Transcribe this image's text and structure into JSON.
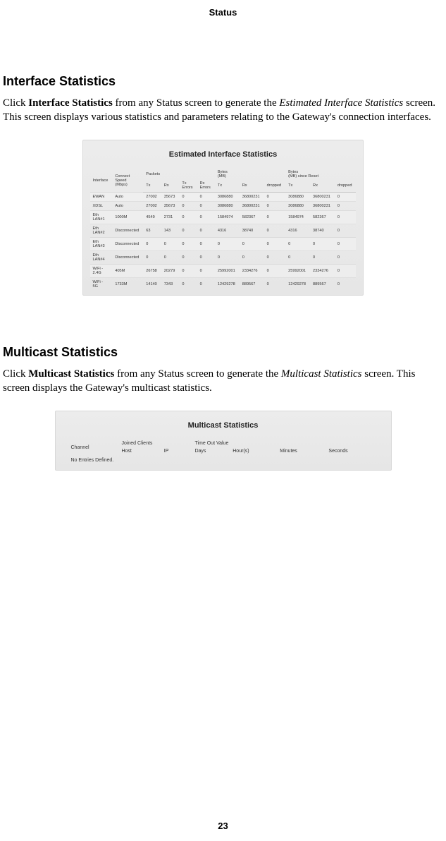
{
  "header": "Status",
  "page_number": "23",
  "section1": {
    "heading": "Interface Statistics",
    "para_pre": "Click ",
    "para_bold": "Interface Statistics",
    "para_mid": " from any Status screen to generate the ",
    "para_ital": "Estimated Interface Statistics",
    "para_post": " screen. This screen displays various statistics and parameters relating to the Gateway's connection interfaces."
  },
  "fig1": {
    "title": "Estimated Interface Statistics",
    "group_headers": {
      "interface": "Interface",
      "connect": "Connect\nSpeed\n(Mbps)",
      "packets": "Packets",
      "bytes": "Bytes\n(MB)",
      "bytes_reset": "Bytes\n(MB) since Reset"
    },
    "sub_headers": [
      "Tx",
      "Rx",
      "Tx\nErrors",
      "Rx\nErrors",
      "Tx",
      "Rx",
      "dropped",
      "Tx",
      "Rx",
      "dropped"
    ],
    "rows": [
      {
        "iface": "EWAN",
        "speed": "Auto",
        "c": [
          "27002",
          "35673",
          "0",
          "0",
          "3086880",
          "36800231",
          "0",
          "3086880",
          "36800231",
          "0"
        ]
      },
      {
        "iface": "XDSL",
        "speed": "Auto",
        "c": [
          "27002",
          "35673",
          "0",
          "0",
          "3086880",
          "36800231",
          "0",
          "3086880",
          "36800231",
          "0"
        ]
      },
      {
        "iface": "Eth\nLAN#1",
        "speed": "1000M",
        "c": [
          "4549",
          "2731",
          "0",
          "0",
          "1584974",
          "582367",
          "0",
          "1584974",
          "582367",
          "0"
        ]
      },
      {
        "iface": "Eth\nLAN#2",
        "speed": "Disconnected",
        "c": [
          "63",
          "143",
          "0",
          "0",
          "4316",
          "38740",
          "0",
          "4316",
          "38740",
          "0"
        ]
      },
      {
        "iface": "Eth\nLAN#3",
        "speed": "Disconnected",
        "c": [
          "0",
          "0",
          "0",
          "0",
          "0",
          "0",
          "0",
          "0",
          "0",
          "0"
        ]
      },
      {
        "iface": "Eth\nLAN#4",
        "speed": "Disconnected",
        "c": [
          "0",
          "0",
          "0",
          "0",
          "0",
          "0",
          "0",
          "0",
          "0",
          "0"
        ]
      },
      {
        "iface": "WiFi -\n2.4G",
        "speed": "405M",
        "c": [
          "26758",
          "20279",
          "0",
          "0",
          "25992001",
          "2334276",
          "0",
          "25992001",
          "2334276",
          "0"
        ]
      },
      {
        "iface": "WiFi -\n5G",
        "speed": "1733M",
        "c": [
          "14140",
          "7343",
          "0",
          "0",
          "12429278",
          "889567",
          "0",
          "12429278",
          "889567",
          "0"
        ]
      }
    ]
  },
  "section2": {
    "heading": "Multicast Statistics",
    "para_pre": "Click ",
    "para_bold": "Multicast Statistics",
    "para_mid": " from any Status screen to generate the ",
    "para_ital": "Multicast Statistics",
    "para_post": " screen. This screen displays the Gateway's multicast statistics."
  },
  "fig2": {
    "title": "Multicast Statistics",
    "group_headers": {
      "channel": "Channel",
      "joined": "Joined Clients",
      "timeout": "Time Out Value"
    },
    "sub_headers": [
      "Host",
      "IP",
      "Days",
      "Hour(s)",
      "Minutes",
      "Seconds"
    ],
    "no_entries": "No Entries Defined."
  }
}
